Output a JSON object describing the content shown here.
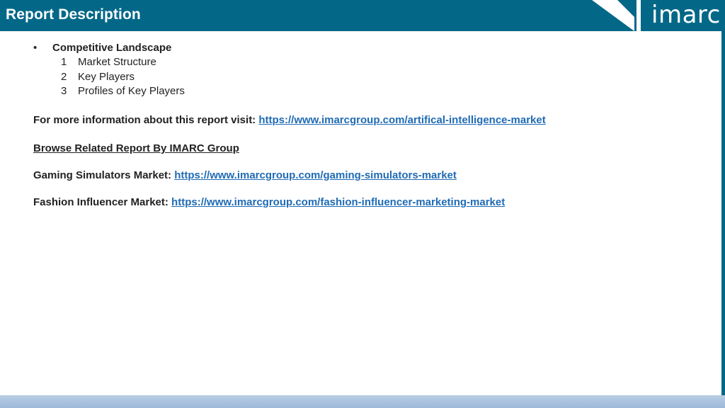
{
  "header": {
    "title": "Report Description",
    "logo_text": "imarc"
  },
  "competitive": {
    "bullet": "•",
    "title": "Competitive Landscape",
    "items": [
      {
        "num": "1",
        "label": "Market Structure"
      },
      {
        "num": "2",
        "label": "Key Players"
      },
      {
        "num": "3",
        "label": "Profiles of Key Players"
      }
    ]
  },
  "more_info": {
    "label": "For more information about this report visit: ",
    "url": "https://www.imarcgroup.com/artifical-intelligence-market"
  },
  "browse": {
    "label": "Browse Related Report By IMARC Group"
  },
  "related": [
    {
      "label": "Gaming Simulators Market: ",
      "url": "https://www.imarcgroup.com/gaming-simulators-market"
    },
    {
      "label": "Fashion Influencer Market: ",
      "url": "https://www.imarcgroup.com/fashion-influencer-marketing-market"
    }
  ],
  "colors": {
    "header": "#036888",
    "link": "#1f6bb5",
    "footer": "#b9cde4"
  }
}
